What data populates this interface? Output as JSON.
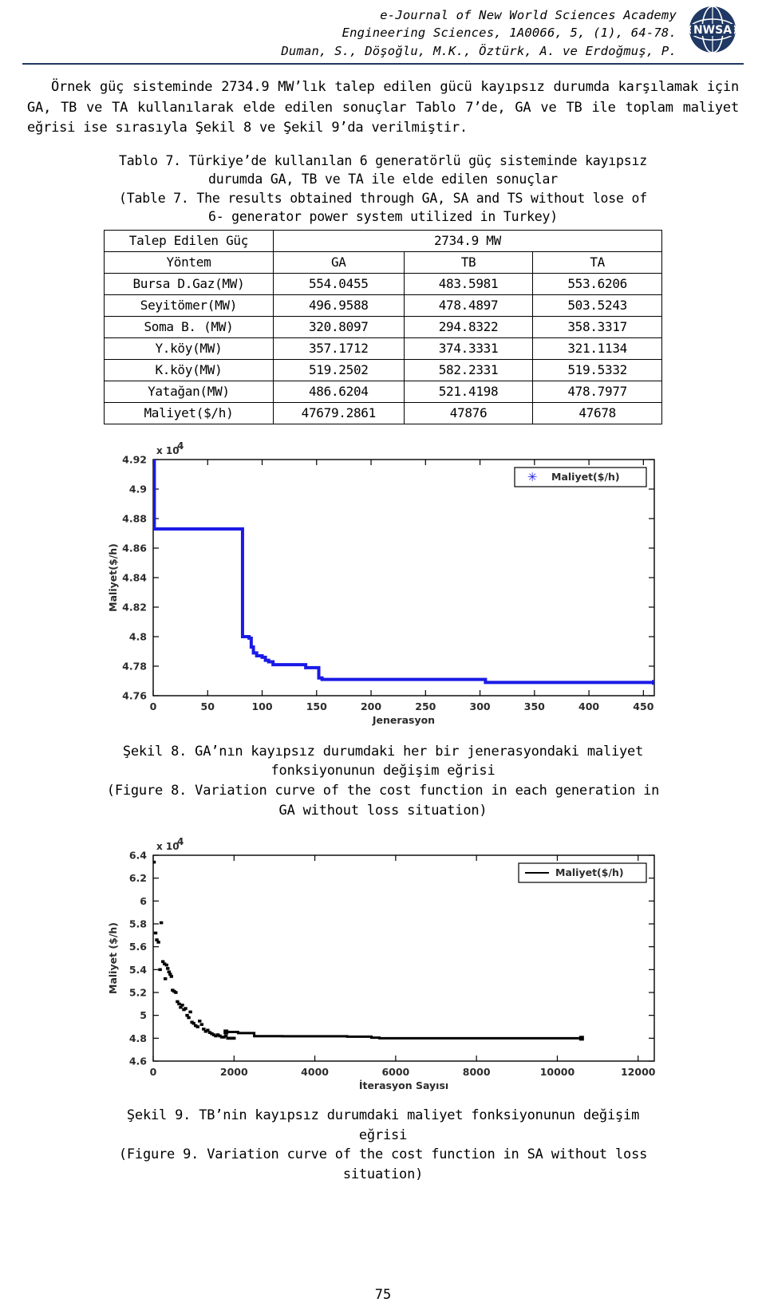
{
  "header": {
    "line1": "e-Journal of New World Sciences Academy",
    "line2": "Engineering Sciences, 1A0066, 5, (1), 64-78.",
    "line3": "Duman, S., Döşoğlu, M.K., Öztürk, A. ve Erdoğmuş, P.",
    "logo_name": "nwsa-globe-logo",
    "logo_text": "NWSA",
    "accent_color": "#1f3864"
  },
  "paragraph": {
    "text": "Örnek güç sisteminde 2734.9 MW’lık talep edilen gücü kayıpsız durumda karşılamak için GA, TB ve TA kullanılarak elde edilen sonuçlar Tablo 7’de, GA ve TB ile toplam maliyet eğrisi ise sırasıyla Şekil 8 ve Şekil 9’da verilmiştir."
  },
  "table_caption": {
    "line1": "Tablo 7. Türkiye’de kullanılan 6 generatörlü güç sisteminde kayıpsız",
    "line2": "durumda GA, TB ve TA ile elde edilen sonuçlar",
    "line3": "(Table 7. The results obtained through GA, SA and TS without lose of",
    "line4": "6- generator power system utilized in Turkey)"
  },
  "table": {
    "demand_label": "Talep Edilen Güç",
    "demand_value": "2734.9 MW",
    "method_label": "Yöntem",
    "columns": [
      "GA",
      "TB",
      "TA"
    ],
    "rows": [
      {
        "label": "Bursa D.Gaz(MW)",
        "values": [
          "554.0455",
          "483.5981",
          "553.6206"
        ]
      },
      {
        "label": "Seyitömer(MW)",
        "values": [
          "496.9588",
          "478.4897",
          "503.5243"
        ]
      },
      {
        "label": "Soma B. (MW)",
        "values": [
          "320.8097",
          "294.8322",
          "358.3317"
        ]
      },
      {
        "label": "Y.köy(MW)",
        "values": [
          "357.1712",
          "374.3331",
          "321.1134"
        ]
      },
      {
        "label": "K.köy(MW)",
        "values": [
          "519.2502",
          "582.2331",
          "519.5332"
        ]
      },
      {
        "label": "Yatağan(MW)",
        "values": [
          "486.6204",
          "521.4198",
          "478.7977"
        ]
      },
      {
        "label": "Maliyet($/h)",
        "values": [
          "47679.2861",
          "47876",
          "47678"
        ]
      }
    ]
  },
  "figure8": {
    "caption_line1": "Şekil 8. GA’nın kayıpsız durumdaki her bir jenerasyondaki maliyet",
    "caption_line2": "fonksiyonunun değişim eğrisi",
    "caption_line3": "(Figure 8. Variation curve of the cost function in each generation in",
    "caption_line4": "GA without loss situation)"
  },
  "figure9": {
    "caption_line1": "Şekil 9. TB’nin kayıpsız durumdaki maliyet fonksiyonunun değişim",
    "caption_line2": "eğrisi",
    "caption_line3": "(Figure 9. Variation curve of the cost function in SA without loss",
    "caption_line4": "situation)"
  },
  "page_number": "75",
  "chart_data": [
    {
      "type": "line",
      "name": "figure-8-ga-cost-curve",
      "title": "",
      "xlabel": "Jenerasyon",
      "ylabel": "Maliyet($/h)",
      "y_exponent": "x 10",
      "y_exponent_sup": "4",
      "legend": [
        "Maliyet($/h)"
      ],
      "legend_position": "top-right",
      "series_color": "#1a1ae6",
      "grid": false,
      "xlim": [
        0,
        460
      ],
      "ylim": [
        4.76,
        4.92
      ],
      "xticks": [
        0,
        50,
        100,
        150,
        200,
        250,
        300,
        350,
        400,
        450
      ],
      "yticks": [
        4.76,
        4.78,
        4.8,
        4.82,
        4.84,
        4.86,
        4.88,
        4.9,
        4.92
      ],
      "x": [
        0,
        1,
        2,
        3,
        5,
        8,
        12,
        18,
        25,
        35,
        45,
        55,
        65,
        75,
        82,
        85,
        88,
        90,
        92,
        95,
        100,
        103,
        106,
        110,
        120,
        130,
        140,
        152,
        155,
        160,
        200,
        250,
        300,
        305,
        310,
        350,
        400,
        450,
        460
      ],
      "y": [
        4.92,
        4.873,
        4.873,
        4.873,
        4.873,
        4.873,
        4.873,
        4.873,
        4.873,
        4.873,
        4.873,
        4.873,
        4.873,
        4.873,
        4.8,
        4.8,
        4.799,
        4.793,
        4.789,
        4.787,
        4.786,
        4.784,
        4.783,
        4.781,
        4.781,
        4.781,
        4.779,
        4.772,
        4.771,
        4.771,
        4.771,
        4.771,
        4.771,
        4.769,
        4.769,
        4.769,
        4.769,
        4.769,
        4.769
      ]
    },
    {
      "type": "scatter-line",
      "name": "figure-9-sa-cost-curve",
      "title": "",
      "xlabel": "İterasyon Sayısı",
      "ylabel": "Maliyet ($/h)",
      "y_exponent": "x 10",
      "y_exponent_sup": "4",
      "legend": [
        "Maliyet($/h)"
      ],
      "legend_position": "top-right",
      "series_color": "#000000",
      "grid": false,
      "xlim": [
        0,
        12400
      ],
      "ylim": [
        4.6,
        6.4
      ],
      "xticks": [
        0,
        2000,
        4000,
        6000,
        8000,
        10000,
        12000
      ],
      "yticks": [
        4.6,
        4.8,
        5.0,
        5.2,
        5.4,
        5.6,
        5.8,
        6.0,
        6.2,
        6.4
      ],
      "scatter_x": [
        20,
        60,
        90,
        130,
        170,
        200,
        240,
        280,
        300,
        330,
        360,
        390,
        420,
        450,
        480,
        520,
        560,
        600,
        640,
        680,
        720,
        760,
        800,
        840,
        880,
        920,
        960,
        1000,
        1050,
        1100,
        1150,
        1200,
        1250,
        1300,
        1350,
        1400,
        1450,
        1500,
        1550,
        1600,
        1650,
        1700,
        1750,
        1800,
        1850,
        1900,
        1950,
        2000
      ],
      "scatter_y": [
        6.34,
        5.72,
        5.66,
        5.64,
        5.4,
        5.81,
        5.47,
        5.45,
        5.32,
        5.44,
        5.41,
        5.38,
        5.36,
        5.34,
        5.22,
        5.21,
        5.2,
        5.12,
        5.1,
        5.07,
        5.09,
        5.05,
        5.06,
        5.0,
        4.98,
        5.03,
        4.94,
        4.93,
        4.91,
        4.9,
        4.95,
        4.92,
        4.88,
        4.86,
        4.87,
        4.85,
        4.84,
        4.83,
        4.82,
        4.83,
        4.82,
        4.81,
        4.81,
        4.82,
        4.8,
        4.8,
        4.8,
        4.8
      ],
      "x": [
        1800,
        2100,
        2400,
        2500,
        2800,
        3200,
        3600,
        4000,
        4400,
        4800,
        5200,
        5400,
        5600,
        6000,
        6400,
        7000,
        8000,
        9000,
        10000,
        10400,
        10600
      ],
      "y": [
        4.855,
        4.845,
        4.845,
        4.818,
        4.818,
        4.817,
        4.817,
        4.817,
        4.817,
        4.814,
        4.814,
        4.805,
        4.8,
        4.8,
        4.8,
        4.8,
        4.8,
        4.8,
        4.8,
        4.8,
        4.8
      ]
    }
  ]
}
